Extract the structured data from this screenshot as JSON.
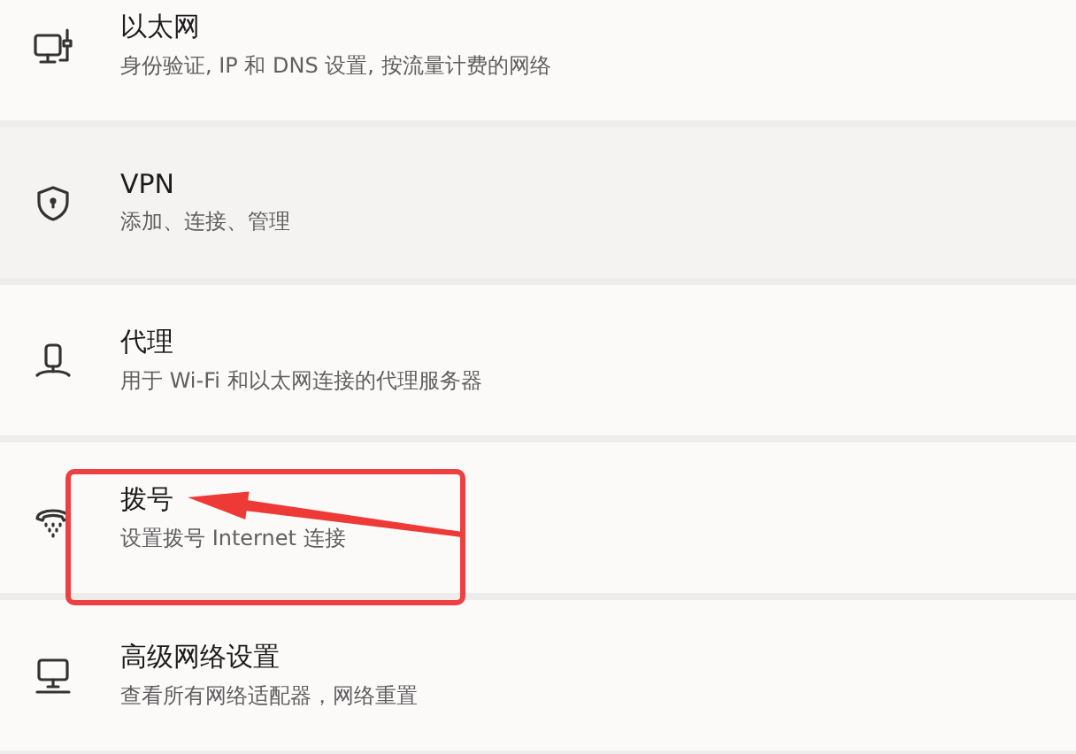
{
  "settings_items": [
    {
      "kind": "ethernet",
      "title": "以太网",
      "subtitle": "身份验证, IP 和 DNS 设置, 按流量计费的网络",
      "hovered": false,
      "highlighted": false
    },
    {
      "kind": "vpn",
      "title": "VPN",
      "subtitle": "添加、连接、管理",
      "hovered": true,
      "highlighted": false
    },
    {
      "kind": "proxy",
      "title": "代理",
      "subtitle": "用于 Wi-Fi 和以太网连接的代理服务器",
      "hovered": false,
      "highlighted": false
    },
    {
      "kind": "dialup",
      "title": "拨号",
      "subtitle": "设置拨号 Internet 连接",
      "hovered": false,
      "highlighted": true
    },
    {
      "kind": "advanced",
      "title": "高级网络设置",
      "subtitle": "查看所有网络适配器，网络重置",
      "hovered": false,
      "highlighted": false
    }
  ]
}
